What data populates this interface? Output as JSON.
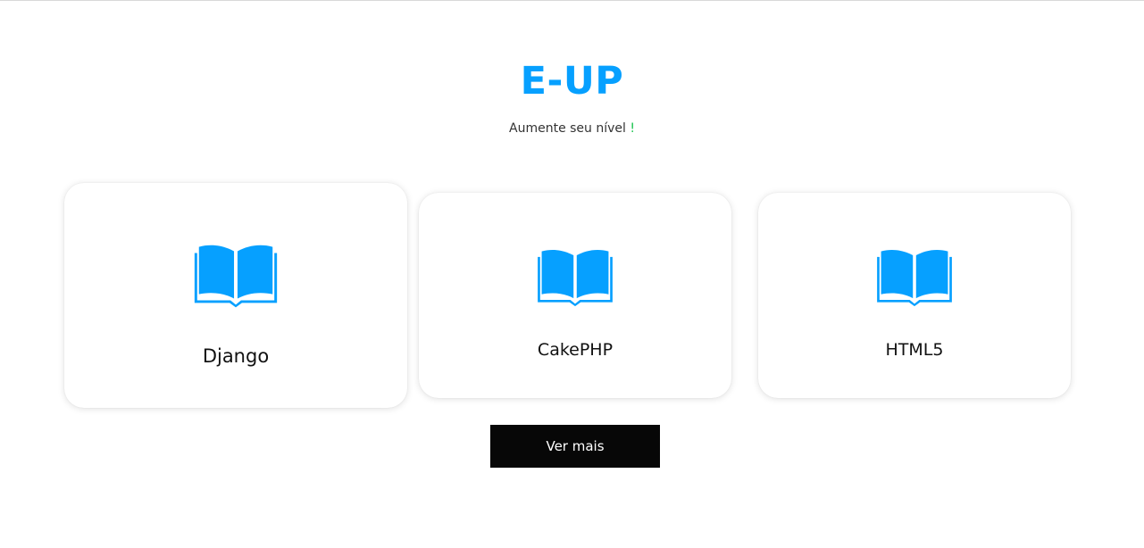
{
  "header": {
    "title": "E-UP",
    "subtitle": "Aumente seu nível",
    "subtitle_mark": "!"
  },
  "cards": [
    {
      "label": "Django",
      "icon": "open-book-icon"
    },
    {
      "label": "CakePHP",
      "icon": "open-book-icon"
    },
    {
      "label": "HTML5",
      "icon": "open-book-icon"
    }
  ],
  "actions": {
    "more_label": "Ver mais"
  },
  "colors": {
    "accent": "#06a0ff",
    "button_bg": "#070707",
    "button_text": "#ffffff",
    "exclamation": "#16c24b"
  }
}
